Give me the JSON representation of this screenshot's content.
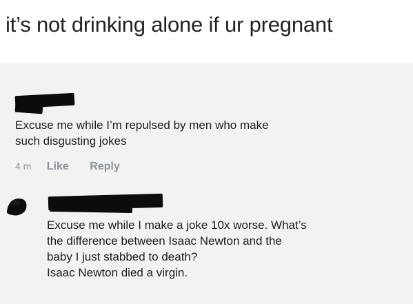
{
  "post": {
    "text": "it’s not drinking alone if ur pregnant"
  },
  "comments": [
    {
      "lines": [
        "Excuse me while I’m repulsed by men who make",
        "such disgusting jokes"
      ],
      "time": "4 m",
      "like_label": "Like",
      "reply_label": "Reply"
    },
    {
      "lines": [
        "Excuse me while I make a joke 10x worse. What’s",
        "the difference between Isaac Newton and the",
        "baby I just stabbed to death?",
        "Isaac Newton died a virgin."
      ]
    }
  ]
}
